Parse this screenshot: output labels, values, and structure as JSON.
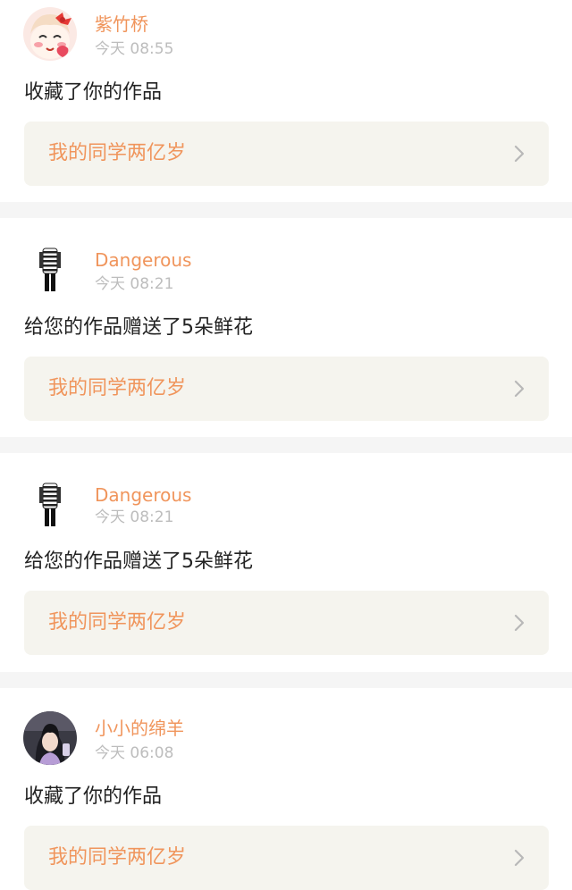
{
  "notifications": [
    {
      "user": "紫竹桥",
      "time": "今天 08:55",
      "message": "收藏了你的作品",
      "work_title": "我的同学两亿岁",
      "avatar_icon": "cartoon-girl-avatar-icon"
    },
    {
      "user": "Dangerous",
      "time": "今天 08:21",
      "message": "给您的作品赠送了5朵鲜花",
      "work_title": "我的同学两亿岁",
      "avatar_icon": "striped-outfit-avatar-icon"
    },
    {
      "user": "Dangerous",
      "time": "今天 08:21",
      "message": "给您的作品赠送了5朵鲜花",
      "work_title": "我的同学两亿岁",
      "avatar_icon": "striped-outfit-avatar-icon"
    },
    {
      "user": "小小的绵羊",
      "time": "今天 06:08",
      "message": "收藏了你的作品",
      "work_title": "我的同学两亿岁",
      "avatar_icon": "photo-portrait-avatar-icon"
    }
  ],
  "colors": {
    "accent": "#f0955c",
    "timestamp": "#bdbdbd",
    "text": "#222222",
    "link_background": "#f5f4ee",
    "page_background": "#f5f5f5",
    "card_background": "#ffffff"
  }
}
